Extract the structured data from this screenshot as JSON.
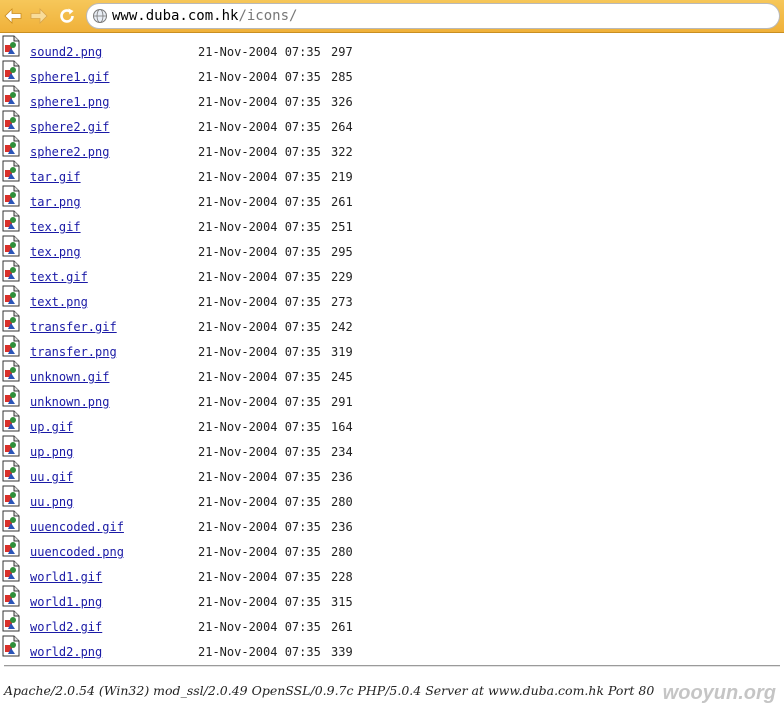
{
  "browser": {
    "url_host": "www.duba.com.hk",
    "url_path": "/icons/"
  },
  "files": [
    {
      "name": "sound2.png",
      "date": "21-Nov-2004 07:35",
      "size": "297"
    },
    {
      "name": "sphere1.gif",
      "date": "21-Nov-2004 07:35",
      "size": "285"
    },
    {
      "name": "sphere1.png",
      "date": "21-Nov-2004 07:35",
      "size": "326"
    },
    {
      "name": "sphere2.gif",
      "date": "21-Nov-2004 07:35",
      "size": "264"
    },
    {
      "name": "sphere2.png",
      "date": "21-Nov-2004 07:35",
      "size": "322"
    },
    {
      "name": "tar.gif",
      "date": "21-Nov-2004 07:35",
      "size": "219"
    },
    {
      "name": "tar.png",
      "date": "21-Nov-2004 07:35",
      "size": "261"
    },
    {
      "name": "tex.gif",
      "date": "21-Nov-2004 07:35",
      "size": "251"
    },
    {
      "name": "tex.png",
      "date": "21-Nov-2004 07:35",
      "size": "295"
    },
    {
      "name": "text.gif",
      "date": "21-Nov-2004 07:35",
      "size": "229"
    },
    {
      "name": "text.png",
      "date": "21-Nov-2004 07:35",
      "size": "273"
    },
    {
      "name": "transfer.gif",
      "date": "21-Nov-2004 07:35",
      "size": "242"
    },
    {
      "name": "transfer.png",
      "date": "21-Nov-2004 07:35",
      "size": "319"
    },
    {
      "name": "unknown.gif",
      "date": "21-Nov-2004 07:35",
      "size": "245"
    },
    {
      "name": "unknown.png",
      "date": "21-Nov-2004 07:35",
      "size": "291"
    },
    {
      "name": "up.gif",
      "date": "21-Nov-2004 07:35",
      "size": "164"
    },
    {
      "name": "up.png",
      "date": "21-Nov-2004 07:35",
      "size": "234"
    },
    {
      "name": "uu.gif",
      "date": "21-Nov-2004 07:35",
      "size": "236"
    },
    {
      "name": "uu.png",
      "date": "21-Nov-2004 07:35",
      "size": "280"
    },
    {
      "name": "uuencoded.gif",
      "date": "21-Nov-2004 07:35",
      "size": "236"
    },
    {
      "name": "uuencoded.png",
      "date": "21-Nov-2004 07:35",
      "size": "280"
    },
    {
      "name": "world1.gif",
      "date": "21-Nov-2004 07:35",
      "size": "228"
    },
    {
      "name": "world1.png",
      "date": "21-Nov-2004 07:35",
      "size": "315"
    },
    {
      "name": "world2.gif",
      "date": "21-Nov-2004 07:35",
      "size": "261"
    },
    {
      "name": "world2.png",
      "date": "21-Nov-2004 07:35",
      "size": "339"
    }
  ],
  "footer": {
    "server_signature": "Apache/2.0.54 (Win32) mod_ssl/2.0.49 OpenSSL/0.9.7c PHP/5.0.4 Server at www.duba.com.hk Port 80",
    "watermark": "wooyun.org"
  },
  "icons": {
    "back": "arrow-left-icon",
    "forward": "arrow-right-icon",
    "reload": "reload-icon",
    "site": "globe-icon",
    "file": "image-file-icon"
  },
  "colors": {
    "toolbar": "#f0b13a",
    "link": "#1a1aa6"
  }
}
